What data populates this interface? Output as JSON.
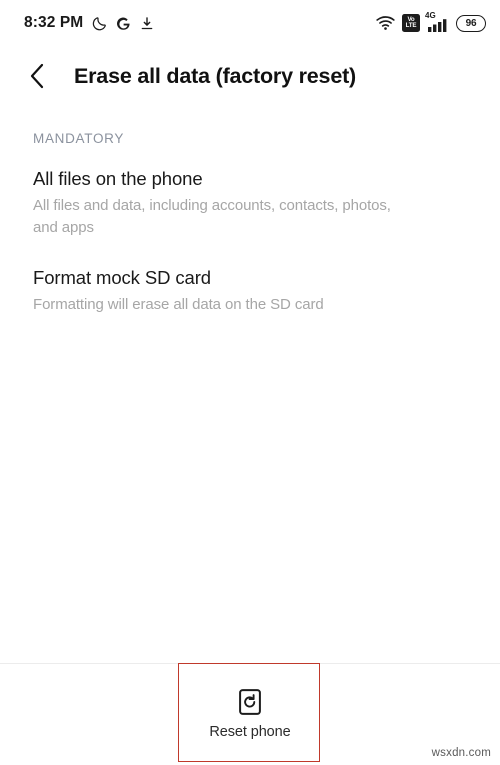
{
  "status_bar": {
    "time": "8:32 PM",
    "dnd_icon": "moon-icon",
    "google_icon": "google-g-icon",
    "download_icon": "download-icon",
    "wifi_icon": "wifi-icon",
    "volte_line1": "Vo",
    "volte_line2": "LTE",
    "network_type": "4G",
    "signal_icon": "signal-bars-icon",
    "battery_level": "96"
  },
  "header": {
    "back_icon": "back-chevron-icon",
    "title": "Erase all data (factory reset)"
  },
  "content": {
    "section_label": "MANDATORY",
    "items": [
      {
        "title": "All files on the phone",
        "subtitle": "All files and data, including accounts, contacts, photos, and apps"
      },
      {
        "title": "Format mock SD card",
        "subtitle": "Formatting will erase all data on the SD card"
      }
    ]
  },
  "bottom_bar": {
    "reset_icon": "reset-phone-icon",
    "reset_label": "Reset phone"
  },
  "annotation": {
    "box_color": "#c0392b"
  },
  "watermark": {
    "text": "wsxdn.com"
  }
}
